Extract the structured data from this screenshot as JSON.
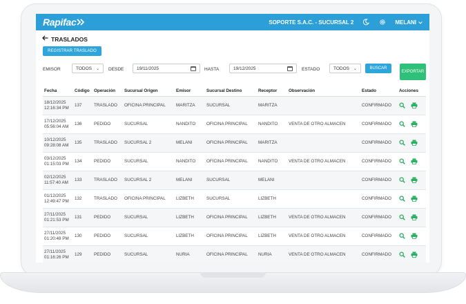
{
  "header": {
    "brand": "Rapifac",
    "company": "SOPORTE S.A.C. - SUCURSAL 2",
    "user": "MELANI",
    "icons": [
      "moon-icon",
      "gear-icon",
      "chevron-down-icon"
    ]
  },
  "page": {
    "title": "TRASLADOS",
    "register_label": "REGISTRAR TRASLADO"
  },
  "filters": {
    "emisor_label": "EMISOR",
    "emisor_value": "TODOS",
    "desde_label": "DESDE",
    "desde_value": "19/11/2025",
    "hasta_label": "HASTA",
    "hasta_value": "19/12/2025",
    "estado_label": "ESTADO",
    "estado_value": "TODOS",
    "buscar_label": "BUSCAR",
    "export_label": "EXPORTAR"
  },
  "table": {
    "columns": [
      "Fecha",
      "Código",
      "Operación",
      "Sucursal Origen",
      "Emisor",
      "Sucursal Destino",
      "Receptor",
      "Observación",
      "Estado",
      "Acciones"
    ],
    "rows": [
      {
        "date": "18/12/2025",
        "time": "12:16:34 PM",
        "code": "137",
        "op": "TRASLADO",
        "origin": "OFICINA PRINCIPAL",
        "emisor": "MARITZA",
        "dest": "SUCURSAL",
        "receptor": "MARITZA",
        "obs": "",
        "estado": "CONFIRMADO"
      },
      {
        "date": "17/12/2025",
        "time": "05:56:04 AM",
        "code": "136",
        "op": "PEDIDO",
        "origin": "SUCURSAL",
        "emisor": "NANDITO",
        "dest": "OFICINA PRINCIPAL",
        "receptor": "NANDITO",
        "obs": "VENTA DE OTRO ALMACEN",
        "estado": "CONFIRMADO"
      },
      {
        "date": "10/12/2025",
        "time": "09:28:08 AM",
        "code": "135",
        "op": "TRASLADO",
        "origin": "SUCURSAL 2",
        "emisor": "MELANI",
        "dest": "OFICINA PRINCIPAL",
        "receptor": "MARITZA",
        "obs": "",
        "estado": "CONFIRMADO"
      },
      {
        "date": "03/12/2025",
        "time": "01:15:03 PM",
        "code": "134",
        "op": "PEDIDO",
        "origin": "SUCURSAL",
        "emisor": "NANDITO",
        "dest": "OFICINA PRINCIPAL",
        "receptor": "NANDITO",
        "obs": "VENTA DE OTRO ALMACEN",
        "estado": "CONFIRMADO"
      },
      {
        "date": "02/12/2025",
        "time": "11:57:40 AM",
        "code": "133",
        "op": "TRASLADO",
        "origin": "SUCURSAL 2",
        "emisor": "MELANI",
        "dest": "SUCURSAL",
        "receptor": "MELANI",
        "obs": "",
        "estado": "CONFIRMADO"
      },
      {
        "date": "01/12/2025",
        "time": "12:49:47 PM",
        "code": "132",
        "op": "TRASLADO",
        "origin": "OFICINA PRINCIPAL",
        "emisor": "LIZBETH",
        "dest": "SUCURSAL",
        "receptor": "LIZBETH",
        "obs": "",
        "estado": "CONFIRMADO"
      },
      {
        "date": "27/11/2025",
        "time": "01:21:53 PM",
        "code": "131",
        "op": "PEDIDO",
        "origin": "SUCURSAL",
        "emisor": "LIZBETH",
        "dest": "OFICINA PRINCIPAL",
        "receptor": "LIZBETH",
        "obs": "VENTA DE OTRO ALMACEN",
        "estado": "CONFIRMADO"
      },
      {
        "date": "27/11/2025",
        "time": "01:20:48 PM",
        "code": "130",
        "op": "PEDIDO",
        "origin": "SUCURSAL",
        "emisor": "LIZBETH",
        "dest": "OFICINA PRINCIPAL",
        "receptor": "LIZBETH",
        "obs": "VENTA DE OTRO ALMACEN",
        "estado": "CONFIRMADO"
      },
      {
        "date": "27/11/2025",
        "time": "01:16:26 PM",
        "code": "129",
        "op": "PEDIDO",
        "origin": "SUCURSAL",
        "emisor": "NURIA",
        "dest": "OFICINA PRINCIPAL",
        "receptor": "NURIA",
        "obs": "VENTA DE OTRO ALMACEN",
        "estado": "CONFIRMADO"
      }
    ]
  },
  "colors": {
    "brand_blue": "#2c9fd9",
    "button_blue": "#2ea5db",
    "export_green": "#2fc07a",
    "action_green": "#27ae60"
  }
}
